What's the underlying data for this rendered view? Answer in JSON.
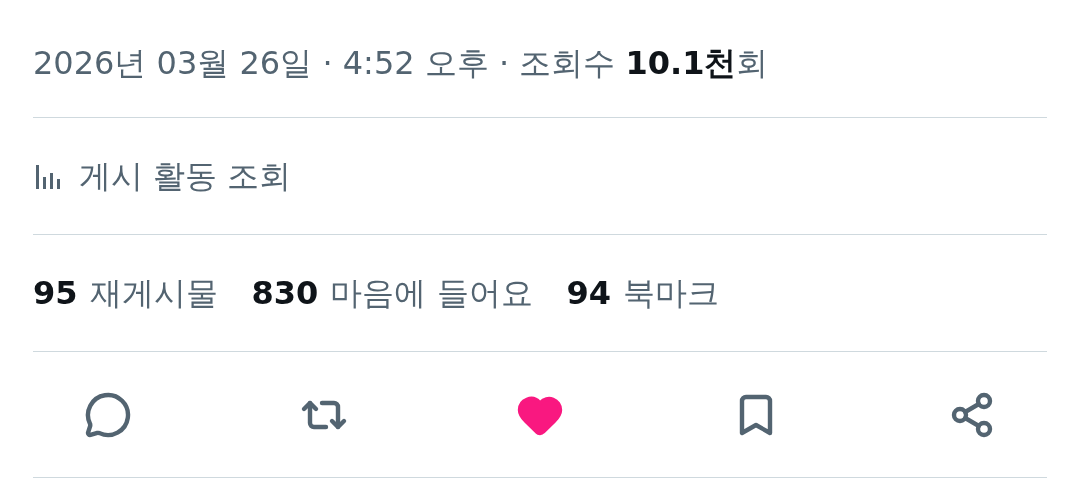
{
  "meta": "2026년 03월 26일 · 4:52 오후 · 조회수 **10.1천**회",
  "activity_link": {
    "label": "게시 활동 조회"
  },
  "stats": [
    {
      "count": "95",
      "label": "재게시물"
    },
    {
      "count": "830",
      "label": "마음에 들어요"
    },
    {
      "count": "94",
      "label": "북마크"
    }
  ],
  "actions": [
    {
      "kind": "reply",
      "selected": false
    },
    {
      "kind": "repost",
      "selected": false
    },
    {
      "kind": "like",
      "selected": true
    },
    {
      "kind": "bookmark",
      "selected": false
    },
    {
      "kind": "share",
      "selected": false
    }
  ]
}
